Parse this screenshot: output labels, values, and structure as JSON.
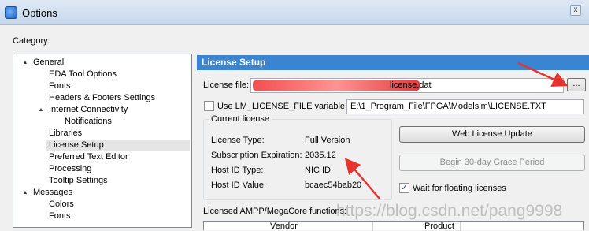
{
  "window": {
    "title": "Options",
    "close_glyph": "x"
  },
  "category_label": "Category:",
  "tree": [
    {
      "label": "General",
      "expander": "▲"
    },
    {
      "label": "EDA Tool Options"
    },
    {
      "label": "Fonts"
    },
    {
      "label": "Headers & Footers Settings"
    },
    {
      "label": "Internet Connectivity",
      "expander": "▲"
    },
    {
      "label": "Notifications"
    },
    {
      "label": "Libraries"
    },
    {
      "label": "License Setup",
      "selected": true
    },
    {
      "label": "Preferred Text Editor"
    },
    {
      "label": "Processing"
    },
    {
      "label": "Tooltip Settings"
    },
    {
      "label": "Messages",
      "expander": "▲"
    },
    {
      "label": "Colors"
    },
    {
      "label": "Fonts"
    }
  ],
  "panel": {
    "header": "License Setup",
    "license_file_label": "License file:",
    "license_file_value_visible": "license.dat",
    "browse_label": "...",
    "use_lm_label": "Use LM_LICENSE_FILE variable:",
    "lm_value": "E:\\1_Program_File\\FPGA\\Modelsim\\LICENSE.TXT",
    "current_license_title": "Current license",
    "license_rows": [
      {
        "label": "License Type:",
        "value": "Full Version"
      },
      {
        "label": "Subscription Expiration:",
        "value": "2035.12"
      },
      {
        "label": "Host ID Type:",
        "value": "NIC ID"
      },
      {
        "label": "Host ID Value:",
        "value": "bcaec54bab20"
      }
    ],
    "web_license_update": "Web License Update",
    "grace_period": "Begin 30-day Grace Period",
    "wait_floating": "Wait for floating licenses",
    "wait_floating_checked": true,
    "ampp_label": "Licensed AMPP/MegaCore functions:",
    "ampp_columns": [
      "Vendor",
      "Product"
    ]
  },
  "watermark": "https://blog.csdn.net/pang9998",
  "colors": {
    "header_blue": "#3b84d2",
    "annotation_red": "#e8322d"
  }
}
